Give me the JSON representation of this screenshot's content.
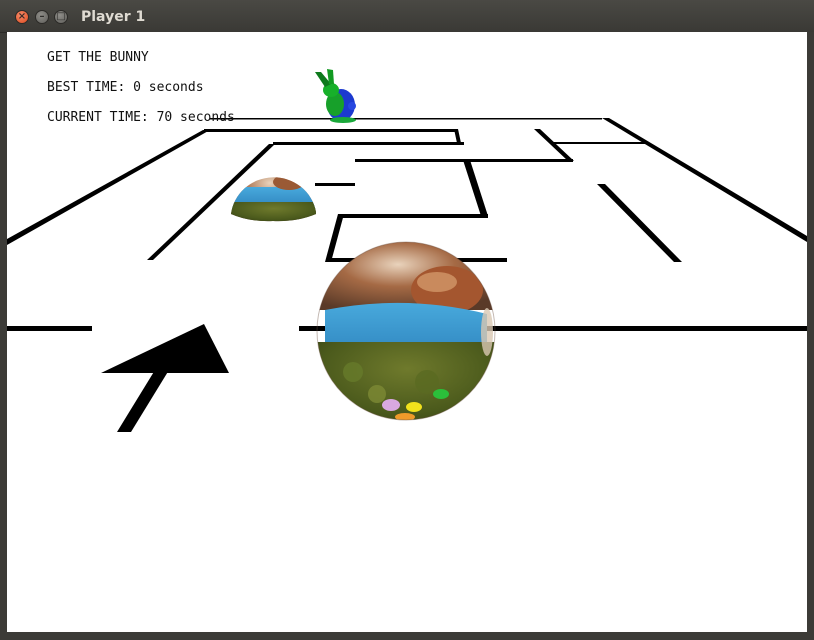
{
  "window": {
    "title": "Player 1",
    "close_glyph": "×",
    "min_glyph": "–",
    "max_glyph": "□"
  },
  "hud": {
    "objective": "GET THE BUNNY",
    "best_time": "BEST TIME: 0 seconds",
    "current_time": "CURRENT TIME: 70 seconds"
  },
  "icons": [
    "close-icon",
    "minimize-icon",
    "maximize-icon",
    "bunny-goal-icon",
    "player-ball-icon",
    "enemy-ball-icon"
  ],
  "colors": {
    "floor": "#ffffff",
    "maze_walls": "#000000",
    "bunny": "#1fa81f",
    "sky": "#3a9ad0"
  }
}
